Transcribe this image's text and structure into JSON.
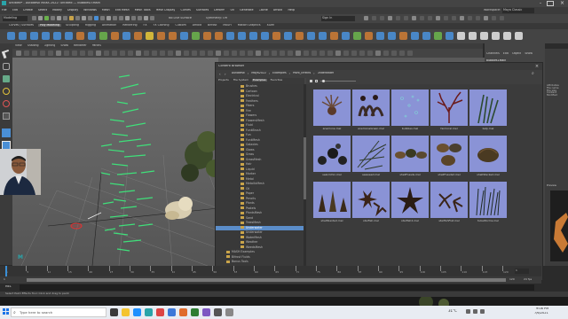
{
  "window": {
    "title": "untitled* - Autodesk MAYA 2022: untitled --- bubbles.f.Main",
    "workspace_label": "Workspace:",
    "workspace_value": "Maya Classic"
  },
  "menubar": {
    "items": [
      "File",
      "Edit",
      "Create",
      "Select",
      "Modify",
      "Display",
      "Windows",
      "Mesh",
      "Edit Mesh",
      "Mesh Tools",
      "Mesh Display",
      "Curves",
      "Surfaces",
      "Deform",
      "UV",
      "Generate",
      "Cache",
      "Arnold",
      "Help"
    ]
  },
  "statusline": {
    "mode": "Modeling",
    "no_live": "No Live Surface",
    "symmetry": "Symmetry: Off",
    "sign_in": "Sign In"
  },
  "shelf": {
    "tabs": [
      "Curves / Surfaces",
      "Poly Modeling",
      "Sculpting",
      "Rigging",
      "Animation",
      "Rendering",
      "FX",
      "FX Caching",
      "Custom",
      "Arnold",
      "Bifrost",
      "MASH",
      "Motion Graphics",
      "XGen"
    ],
    "active": "Poly Modeling"
  },
  "viewport_menu": [
    "View",
    "Shading",
    "Lighting",
    "Show",
    "Renderer",
    "Panels"
  ],
  "channel_box": {
    "tabs": [
      "Channels",
      "Edit",
      "Object",
      "Show"
    ],
    "object": "bubbles1Main"
  },
  "content_browser": {
    "title": "Content Browser",
    "path": [
      "Autodesk",
      "Maya2022",
      "Examples",
      "Paint_Effects",
      "Underwater"
    ],
    "tabs": [
      "Projects",
      "File System",
      "Examples",
      "Favorites"
    ],
    "active_tab": "Examples",
    "tree": [
      "Brushes",
      "Cartoon",
      "Electrical",
      "Feathers",
      "Fibers",
      "Fire",
      "Flowers",
      "FlowersMesh",
      "Fluid",
      "FunkBrush",
      "Fun",
      "FunkMesh",
      "Galaxies",
      "Glows",
      "Grass",
      "GrassMesh",
      "Hair",
      "Liquid",
      "Marker",
      "Metal",
      "MetallicMesh",
      "Oil",
      "Paper",
      "Pencils",
      "Plants",
      "Pastels",
      "PlantsMesh",
      "Sand",
      "TreesMesh",
      "Underwater",
      "Underwater",
      "WaterMesh",
      "Weather",
      "WeedsMesh",
      "MASH Examples",
      "Bifrost Fluids",
      "Bonus Tools"
    ],
    "selected_index": 29,
    "thumbnails": [
      {
        "label": "anemone.mel"
      },
      {
        "label": "anemoneGreen.mel"
      },
      {
        "label": "bubbles.mel"
      },
      {
        "label": "fanCoral.mel"
      },
      {
        "label": "kelp.mel"
      },
      {
        "label": "seaUrchin.mel"
      },
      {
        "label": "seaweed.mel"
      },
      {
        "label": "shellFossils.mel"
      },
      {
        "label": "shellFossils2.mel"
      },
      {
        "label": "shellStacked.mel"
      },
      {
        "label": "shellSlanted.mel"
      },
      {
        "label": "starfish.mel"
      },
      {
        "label": "starfish2.mel"
      },
      {
        "label": "starfishFlat.mel"
      },
      {
        "label": "tubeWorms.mel"
      }
    ]
  },
  "right_panel": {
    "labels": [
      "Attributes",
      "File name",
      "File size",
      "Content",
      "Modified"
    ],
    "preview": "Preview"
  },
  "timeline": {
    "ticks": [
      "1",
      "5",
      "10",
      "15",
      "20",
      "25",
      "30",
      "35",
      "40",
      "45",
      "50",
      "55",
      "60",
      "65",
      "70",
      "75",
      "80",
      "85",
      "90",
      "95",
      "100",
      "105",
      "110",
      "115",
      "120"
    ],
    "current": "1",
    "range_start": "1",
    "range_end": "120",
    "total_end": "200",
    "fps": "24 fps"
  },
  "cmdline": {
    "label": "MEL"
  },
  "help_line": "Select Paint Effects Tool: Click and drag to paint",
  "taskbar": {
    "search_placeholder": "Type here to search",
    "weather": "31°C",
    "time": "9:08 PM",
    "date": "7/6/2021"
  }
}
